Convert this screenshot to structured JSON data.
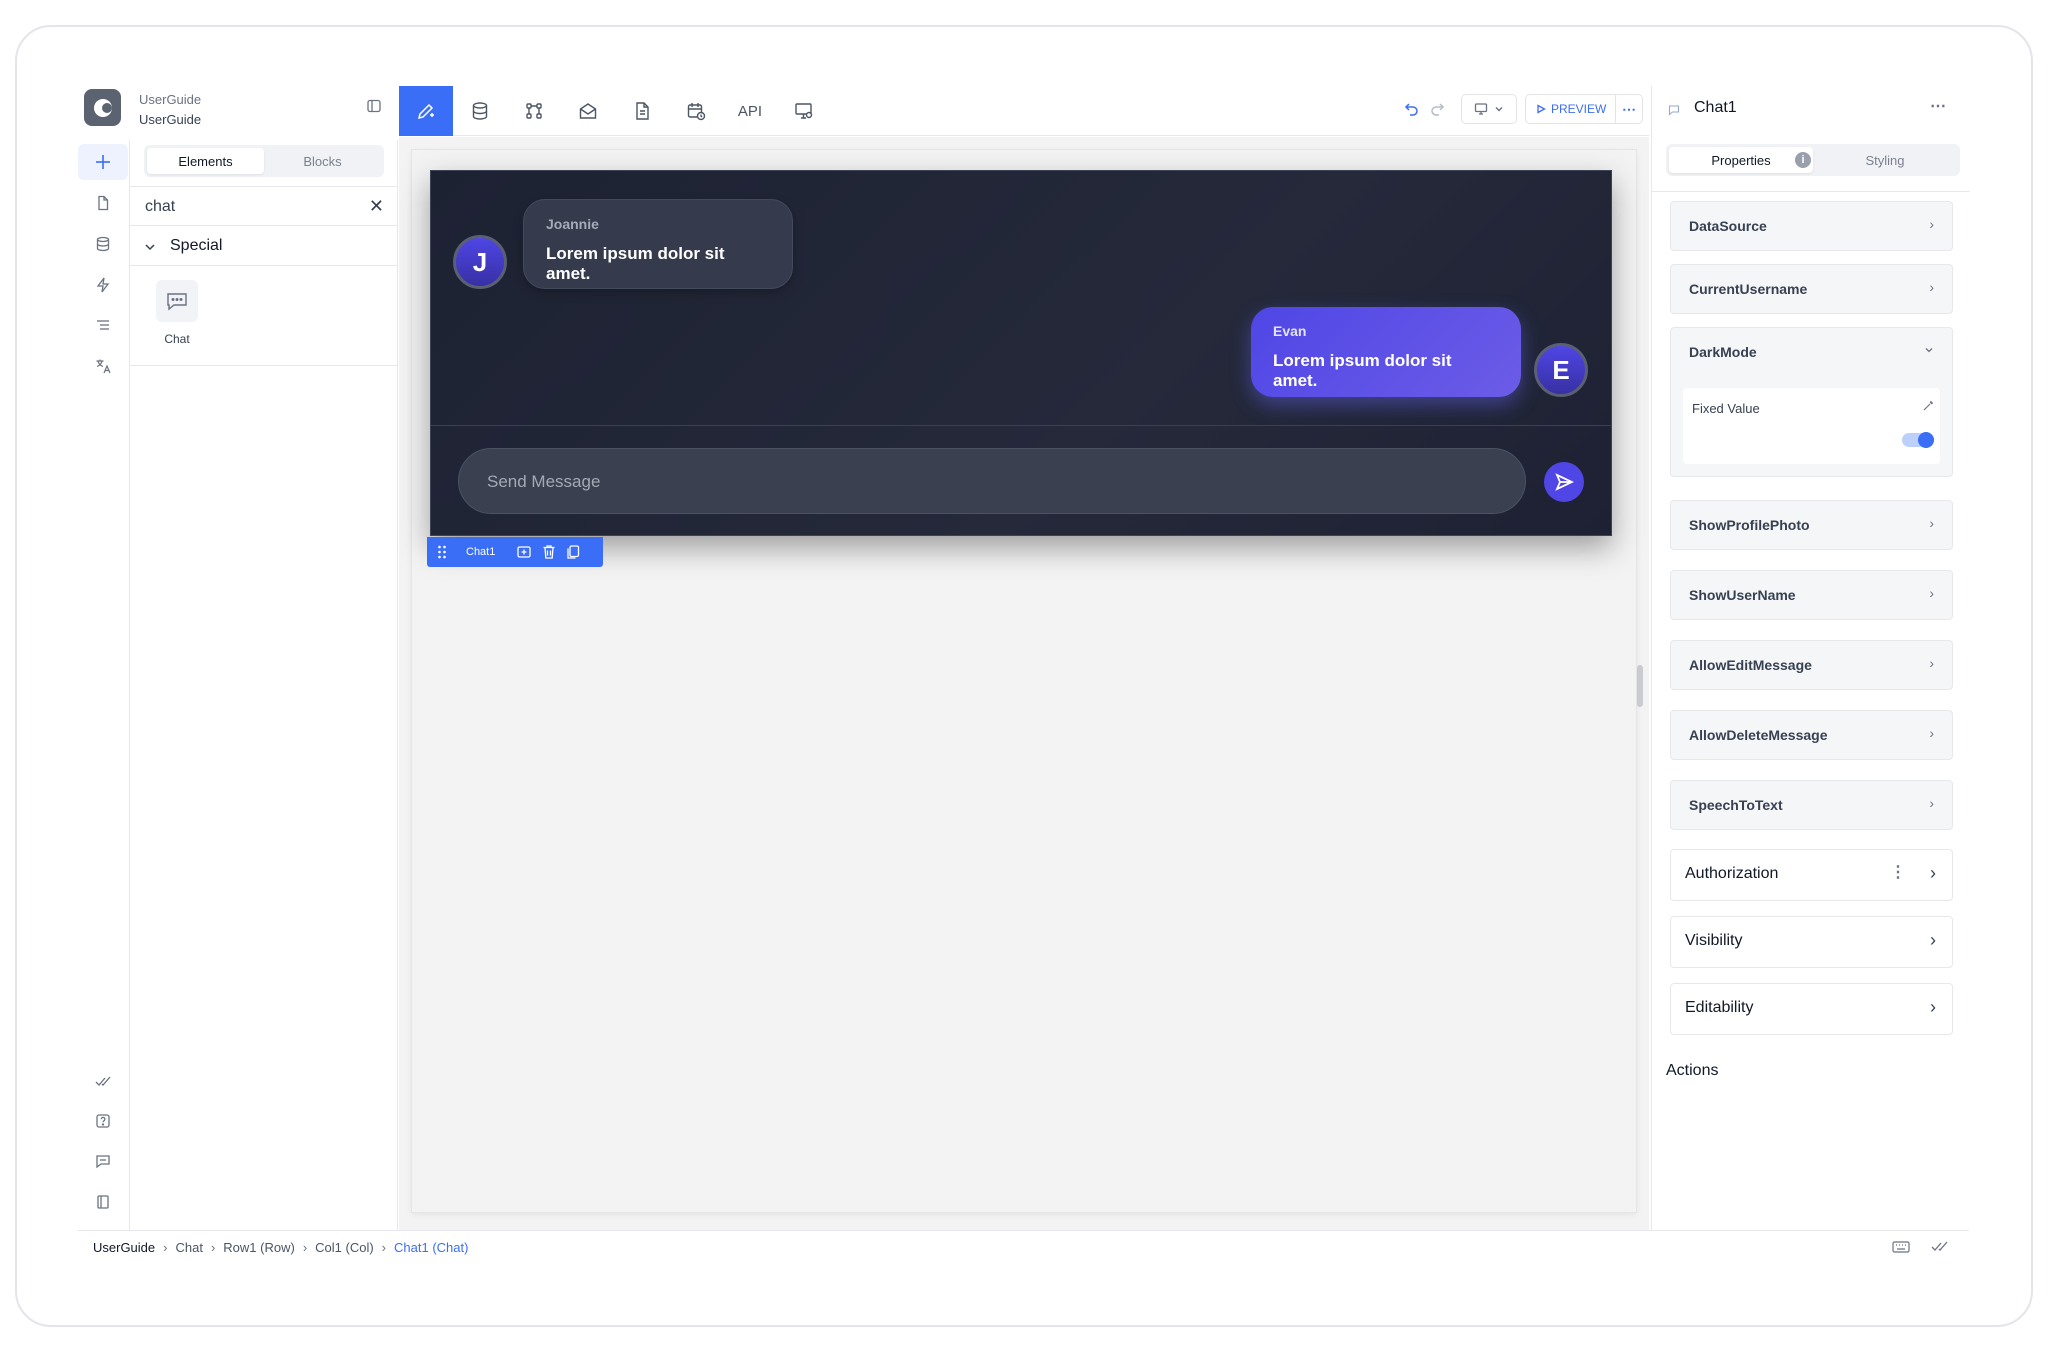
{
  "project": {
    "name": "UserGuide",
    "app": "UserGuide"
  },
  "left_panel": {
    "tabs": [
      "Elements",
      "Blocks"
    ],
    "active_tab": "Elements",
    "search_value": "chat",
    "category": "Special",
    "items": [
      {
        "label": "Chat",
        "icon": "chat-bubble-icon"
      }
    ]
  },
  "toolbar": {
    "api_label": "API",
    "preview_label": "PREVIEW",
    "accent": "#3b6ef6"
  },
  "chat": {
    "messages": [
      {
        "initial": "J",
        "name": "Joannie",
        "text": "Lorem ipsum dolor sit amet.",
        "side": "left"
      },
      {
        "initial": "E",
        "name": "Evan",
        "text": "Lorem ipsum dolor sit amet.",
        "side": "right"
      }
    ],
    "input_placeholder": "Send Message",
    "selection_label": "Chat1"
  },
  "right_panel": {
    "title": "Chat1",
    "tabs": [
      "Properties",
      "Styling"
    ],
    "info_glyph": "i",
    "properties": [
      {
        "label": "DataSource"
      },
      {
        "label": "CurrentUsername"
      },
      {
        "label": "DarkMode",
        "fixed_value_label": "Fixed Value",
        "toggle_on": true
      },
      {
        "label": "ShowProfilePhoto"
      },
      {
        "label": "ShowUserName"
      },
      {
        "label": "AllowEditMessage"
      },
      {
        "label": "AllowDeleteMessage"
      },
      {
        "label": "SpeechToText"
      }
    ],
    "sections": [
      "Authorization",
      "Visibility",
      "Editability"
    ],
    "actions_label": "Actions"
  },
  "breadcrumb": [
    "UserGuide",
    "Chat",
    "Row1 (Row)",
    "Col1 (Col)",
    "Chat1 (Chat)"
  ]
}
